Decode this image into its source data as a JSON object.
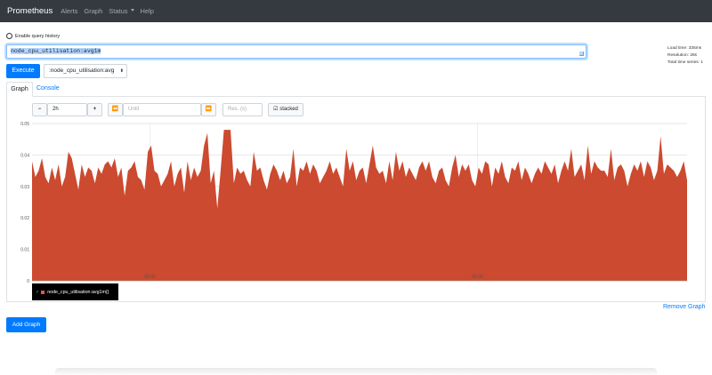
{
  "navbar": {
    "brand": "Prometheus",
    "alerts": "Alerts",
    "graph": "Graph",
    "status": "Status",
    "help": "Help"
  },
  "history_label": "Enable query history",
  "query": "node_cpu_utilisation:avg1m",
  "stats": {
    "load_time": "Load time: 335ms",
    "resolution": "Resolution: 28s",
    "total_series": "Total time series: 1"
  },
  "execute_label": "Execute",
  "metric_select": ":node_cpu_utilisation:avg",
  "tabs": {
    "graph": "Graph",
    "console": "Console"
  },
  "controls": {
    "minus": "−",
    "range": "2h",
    "plus": "+",
    "back": "⏪",
    "until_placeholder": "Until",
    "forward": "⏩",
    "res_placeholder": "Res. (s)",
    "stacked": "stacked"
  },
  "series_color": "#cc4a2f",
  "legend_label": "node_cpu_utilisation:avg1m{}",
  "remove_label": "Remove Graph",
  "add_label": "Add Graph",
  "chart_data": {
    "type": "area",
    "ylim": [
      0,
      0.05
    ],
    "yticks": [
      "0.05",
      "0.04",
      "0.03",
      "0.02",
      "0.01",
      "0"
    ],
    "xticks": [
      "00:00",
      "00:30"
    ],
    "series": [
      {
        "name": "node_cpu_utilisation:avg1m{}",
        "values": [
          0.038,
          0.033,
          0.035,
          0.039,
          0.033,
          0.031,
          0.036,
          0.032,
          0.037,
          0.03,
          0.033,
          0.041,
          0.039,
          0.034,
          0.029,
          0.037,
          0.033,
          0.036,
          0.035,
          0.031,
          0.036,
          0.034,
          0.037,
          0.038,
          0.036,
          0.039,
          0.033,
          0.036,
          0.027,
          0.035,
          0.036,
          0.038,
          0.033,
          0.032,
          0.029,
          0.041,
          0.043,
          0.035,
          0.034,
          0.03,
          0.032,
          0.034,
          0.038,
          0.03,
          0.034,
          0.036,
          0.028,
          0.038,
          0.032,
          0.036,
          0.033,
          0.035,
          0.043,
          0.047,
          0.031,
          0.035,
          0.023,
          0.035,
          0.048,
          0.048,
          0.048,
          0.031,
          0.036,
          0.034,
          0.035,
          0.032,
          0.03,
          0.041,
          0.035,
          0.036,
          0.032,
          0.029,
          0.034,
          0.037,
          0.035,
          0.032,
          0.035,
          0.031,
          0.033,
          0.042,
          0.03,
          0.036,
          0.035,
          0.038,
          0.034,
          0.037,
          0.035,
          0.031,
          0.033,
          0.035,
          0.038,
          0.034,
          0.036,
          0.033,
          0.03,
          0.042,
          0.035,
          0.038,
          0.032,
          0.035,
          0.036,
          0.031,
          0.037,
          0.043,
          0.036,
          0.034,
          0.035,
          0.031,
          0.038,
          0.032,
          0.041,
          0.035,
          0.038,
          0.033,
          0.036,
          0.034,
          0.032,
          0.036,
          0.038,
          0.035,
          0.038,
          0.033,
          0.031,
          0.035,
          0.036,
          0.032,
          0.03,
          0.036,
          0.04,
          0.033,
          0.037,
          0.035,
          0.037,
          0.032,
          0.03,
          0.036,
          0.034,
          0.038,
          0.037,
          0.03,
          0.036,
          0.034,
          0.038,
          0.033,
          0.031,
          0.036,
          0.035,
          0.038,
          0.032,
          0.036,
          0.034,
          0.031,
          0.034,
          0.036,
          0.034,
          0.038,
          0.036,
          0.034,
          0.037,
          0.031,
          0.035,
          0.038,
          0.035,
          0.042,
          0.033,
          0.035,
          0.037,
          0.032,
          0.043,
          0.034,
          0.038,
          0.036,
          0.035,
          0.035,
          0.033,
          0.042,
          0.032,
          0.036,
          0.037,
          0.035,
          0.03,
          0.034,
          0.037,
          0.035,
          0.038,
          0.033,
          0.038,
          0.036,
          0.032,
          0.035,
          0.046,
          0.034,
          0.037,
          0.036,
          0.035,
          0.033,
          0.035,
          0.038,
          0.032
        ]
      }
    ]
  }
}
